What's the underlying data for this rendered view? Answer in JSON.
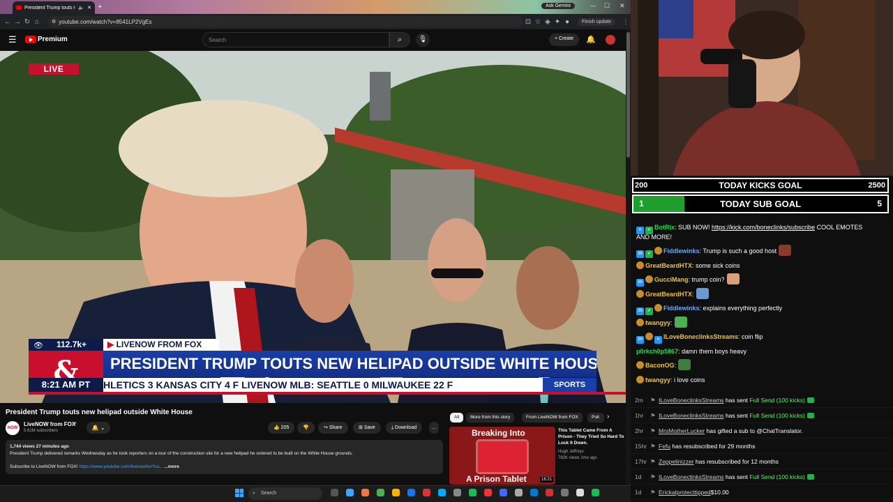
{
  "browser": {
    "tab_title": "President Trump touts new",
    "new_tab": "+",
    "ask_gemini": "Ask Gemini",
    "url": "youtube.com/watch?v=8541LP2VgEs",
    "finish_update": "Finish update"
  },
  "youtube": {
    "brand": "Premium",
    "search_placeholder": "Search",
    "create_label": "+ Create",
    "video": {
      "live_badge": "LIVE",
      "viewers": "112.7k+",
      "network": "LIVENOW FROM FOX",
      "headline": "PRESIDENT TRUMP TOUTS NEW HELIPAD OUTSIDE WHITE HOUSE",
      "logo_text": "&",
      "clock": "8:21 AM PT",
      "ticker": "HLETICS  3  KANSAS CITY  4  F   LIVENOW   MLB:  SEATTLE  0  MILWAUKEE  22  F",
      "sports_label": "SPORTS"
    },
    "title": "President Trump touts new helipad outside White House",
    "channel": {
      "avatar_text": "NOW",
      "name": "LiveNOW from FOX",
      "subscribers": "5.61M subscribers"
    },
    "actions": {
      "likes": "205",
      "share": "Share",
      "save": "Save",
      "download": "Download",
      "more": "..."
    },
    "description": {
      "meta": "1,744 views  27 minutes ago",
      "text": "President Trump delivered remarks Wednesday as he took reporters on a tour of the construction site for a new helipad he ordered to be built on the White House grounds.",
      "subscribe_text": "Subscribe to LiveNOW from FOX!",
      "link": "https://www.youtube.com/livenowfox?su...",
      "more": "...more"
    },
    "chips": [
      "All",
      "More from this story",
      "From LiveNOW from FOX",
      "Poli"
    ],
    "related": {
      "thumb_top": "Breaking Into",
      "thumb_bottom": "A Prison Tablet",
      "duration": "16:21",
      "title": "This Tablet Came From A Prison - They Tried So Hard To Lock It Down.",
      "channel": "Hugh Jeffreys",
      "meta": "782K views  1mo ago"
    }
  },
  "stream": {
    "kicks_goal": {
      "left": "200",
      "label": "TODAY KICKS GOAL",
      "right": "2500",
      "progress": 0
    },
    "sub_goal": {
      "left": "1",
      "label": "TODAY SUB GOAL",
      "right": "5",
      "progress": 0.2
    },
    "chat": [
      {
        "user": "BotRix",
        "color": "#1fdf4c",
        "badges": [
          "bot",
          "mod"
        ],
        "text": ": SUB NOW! ",
        "link": "https://kick.com/boneclinks/subscribe",
        "after": " COOL EMOTES",
        "line2": "AND MORE!"
      },
      {
        "user": "Fiddlewinks",
        "color": "#6fa8ff",
        "badges": [
          "sub",
          "mod",
          "ava"
        ],
        "text": ": Trump is such a good host",
        "emote": "#8a3a2a"
      },
      {
        "user": "GreatBeardHTX",
        "color": "#f0c040",
        "badges": [
          "ava"
        ],
        "text": ": some sick coins"
      },
      {
        "user": "GucciMang",
        "color": "#f0c040",
        "badges": [
          "sub",
          "ava"
        ],
        "text": ": trump coin?",
        "emote": "#d9a07a"
      },
      {
        "user": "GreatBeardHTX",
        "color": "#f0c040",
        "badges": [
          "ava"
        ],
        "text": ":",
        "emote": "#6a9ad0"
      },
      {
        "user": "Fiddlewinks",
        "color": "#6fa8ff",
        "badges": [
          "sub",
          "mod",
          "ava"
        ],
        "text": ": explains everything perfectly"
      },
      {
        "user": "twangyy",
        "color": "#f0c040",
        "badges": [
          "ava"
        ],
        "text": ":",
        "emote": "#4caf50"
      },
      {
        "user": "ILoveBoneclinksStreams",
        "color": "#f0c040",
        "badges": [
          "sub",
          "ava",
          "bot"
        ],
        "text": ": coin flip"
      },
      {
        "user": "p0rkch0p5867",
        "color": "#1fdf4c",
        "badges": [],
        "text": ": damn them boys heavy"
      },
      {
        "user": "BaconOG",
        "color": "#f0c040",
        "badges": [
          "ava"
        ],
        "text": ":",
        "emote": "#3e7d3e"
      },
      {
        "user": "twangyy",
        "color": "#f0c040",
        "badges": [
          "ava"
        ],
        "text": ": i love coins"
      }
    ],
    "events": [
      {
        "time": "2m",
        "user": "ILoveBoneclinksStreams",
        "text": " has sent ",
        "special": "Full Send (100 kicks)",
        "kick": true
      },
      {
        "time": "1hr",
        "user": "ILoveBoneclinksStreams",
        "text": " has sent ",
        "special": "Full Send (100 kicks)",
        "kick": true
      },
      {
        "time": "2hr",
        "user": "MrsMotherLucker",
        "text": " has gifted a sub to @ChatTranslator.",
        "special": "",
        "kick": false
      },
      {
        "time": "15hr",
        "user": "Fefu",
        "text": " has resubscribed for 29 months",
        "special": "",
        "kick": false
      },
      {
        "time": "17hr",
        "user": "Zeppelinizzer",
        "text": " has resubscribed for 12 months",
        "special": "",
        "kick": false
      },
      {
        "time": "1d",
        "user": "ILoveBoneclinksStreams",
        "text": " has sent ",
        "special": "Full Send (100 kicks)",
        "kick": true
      },
      {
        "time": "1d",
        "user": "Erickalprotecttipped",
        "text": "$10.00",
        "special": "",
        "kick": false
      }
    ]
  },
  "taskbar": {
    "search": "Search"
  },
  "colors": {
    "live_red": "#c8102e",
    "fox_blue": "#1a3fa8",
    "kick_green": "#1f9e2e"
  }
}
